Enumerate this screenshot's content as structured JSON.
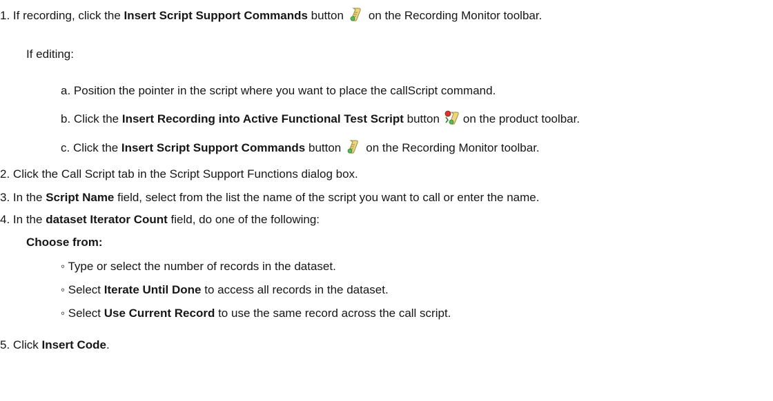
{
  "steps": {
    "s1": {
      "num": "1.",
      "pre": "If recording, click the ",
      "bold": "Insert Script Support Commands",
      "mid": " button",
      "icon": "script-support-icon",
      "post": "on the Recording Monitor toolbar."
    },
    "if_editing": "If editing:",
    "sub_a": {
      "num": "a.",
      "text": "Position the pointer in the script where you want to place the callScript command."
    },
    "sub_b": {
      "num": "b.",
      "pre": "Click the ",
      "bold": "Insert Recording into Active Functional Test Script",
      "mid": " button",
      "icon": "insert-recording-icon",
      "post": "on the product toolbar."
    },
    "sub_c": {
      "num": "c.",
      "pre": "Click the ",
      "bold": "Insert Script Support Commands",
      "mid": " button",
      "icon": "script-support-icon",
      "post": "on the Recording Monitor toolbar."
    },
    "s2": {
      "num": "2.",
      "text": "Click the Call Script tab in the Script Support Functions dialog box."
    },
    "s3": {
      "num": "3.",
      "pre": "In the ",
      "bold": "Script Name",
      "post": " field, select from the list the name of the script you want to call or enter the name."
    },
    "s4": {
      "num": "4.",
      "pre": "In the ",
      "bold": "dataset Iterator Count",
      "post": " field, do one of the following:"
    },
    "choose_from": "Choose from:",
    "opt1": {
      "bullet": "◦",
      "text": "Type or select the number of records in the dataset."
    },
    "opt2": {
      "bullet": "◦",
      "pre": "Select ",
      "bold": "Iterate Until Done",
      "post": " to access all records in the dataset."
    },
    "opt3": {
      "bullet": "◦",
      "pre": "Select ",
      "bold": "Use Current Record",
      "post": " to use the same record across the call script."
    },
    "s5": {
      "num": "5.",
      "pre": "Click ",
      "bold": "Insert Code",
      "post": "."
    }
  },
  "colors": {
    "text": "#161616",
    "icon_scroll": "#e8d27a",
    "icon_green": "#4caf50",
    "icon_red": "#d9342b"
  }
}
